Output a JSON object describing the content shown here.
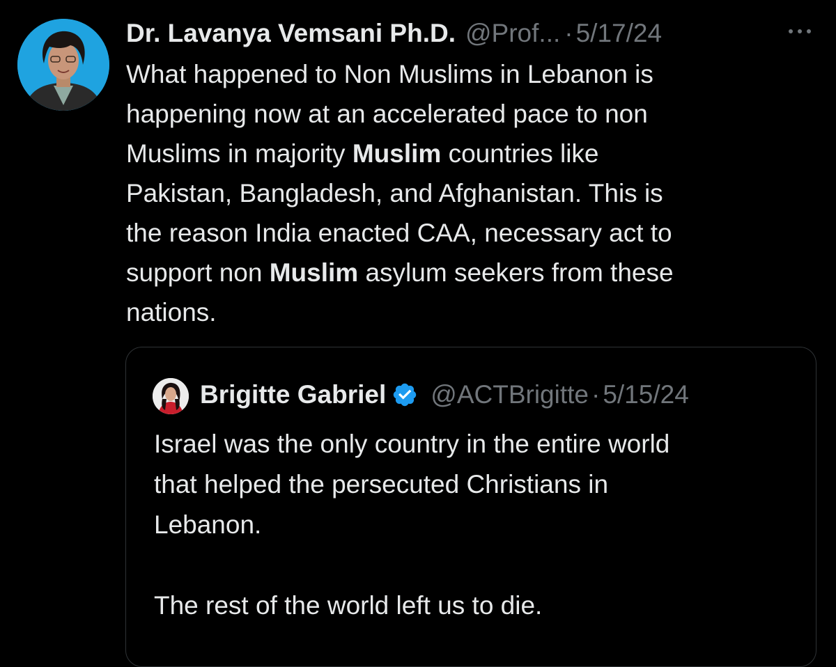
{
  "tweet": {
    "author_name": "Dr. Lavanya Vemsani Ph.D.",
    "handle": "@Prof...",
    "separator": "·",
    "date": "5/17/24",
    "avatar_icon": "profile-photo",
    "more_icon": "more-horizontal-icon",
    "body_lines": [
      [
        "What happened to Non Muslims in Lebanon is"
      ],
      [
        "happening now at an accelerated pace to non"
      ],
      [
        "Muslims in majority ",
        "Muslim",
        " countries like"
      ],
      [
        "Pakistan, Bangladesh, and Afghanistan. This is"
      ],
      [
        "the reason India enacted CAA, necessary act to"
      ],
      [
        "support non ",
        "Muslim",
        " asylum seekers from these"
      ],
      [
        "nations."
      ]
    ]
  },
  "quoted_tweet": {
    "author_name": "Brigitte Gabriel",
    "verified": true,
    "verified_icon": "verified-badge-icon",
    "handle": "@ACTBrigitte",
    "separator": "·",
    "date": "5/15/24",
    "text_lines": [
      "Israel was the only country in the entire world",
      "that helped the persecuted Christians in",
      "Lebanon.",
      "",
      "The rest of the world left us to die."
    ]
  },
  "colors": {
    "background": "#000000",
    "primary_text": "#e7e9ea",
    "secondary_text": "#71767b",
    "border": "#2f3336",
    "verified_blue": "#1d9bf0",
    "avatar_background": "#1fa3e0"
  }
}
